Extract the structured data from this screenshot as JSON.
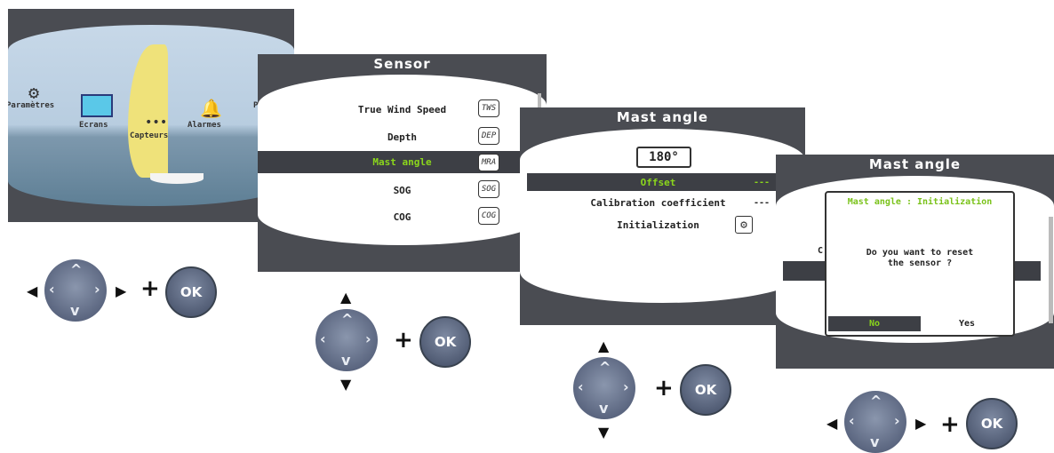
{
  "screen1": {
    "menu": [
      {
        "label": "Paramètres",
        "icon": "gear-icon"
      },
      {
        "label": "Ecrans",
        "icon": "screens-icon"
      },
      {
        "label": "Capteurs",
        "icon": "sensor-icon"
      },
      {
        "label": "Alarmes",
        "icon": "bell-icon"
      },
      {
        "label": "P"
      }
    ]
  },
  "screen2": {
    "title": "Sensor",
    "items": [
      {
        "label": "True Wind Speed",
        "abbr": "TWS"
      },
      {
        "label": "Depth",
        "abbr": "DEP"
      },
      {
        "label": "Mast angle",
        "abbr": "MRA"
      },
      {
        "label": "SOG",
        "abbr": "SOG"
      },
      {
        "label": "COG",
        "abbr": "COG"
      }
    ]
  },
  "screen3": {
    "title": "Mast angle",
    "value": "180°",
    "rows": [
      {
        "label": "Offset",
        "value": "---"
      },
      {
        "label": "Calibration coefficient",
        "value": "---"
      },
      {
        "label": "Initialization",
        "icon": "gear-icon"
      }
    ]
  },
  "screen4": {
    "title": "Mast angle",
    "dialog": {
      "title": "Mast angle : Initialization",
      "message_line1": "Do you want to reset",
      "message_line2": "the sensor ?",
      "no_label": "No",
      "yes_label": "Yes"
    },
    "partial_letter": "C"
  },
  "controls": {
    "ok_label": "OK",
    "plus": "+",
    "left_arrow": "◀",
    "right_arrow": "▶",
    "up_arrow": "▲",
    "down_arrow": "▼"
  },
  "colors": {
    "accent": "#8bd61c",
    "frame": "#4a4c52"
  }
}
